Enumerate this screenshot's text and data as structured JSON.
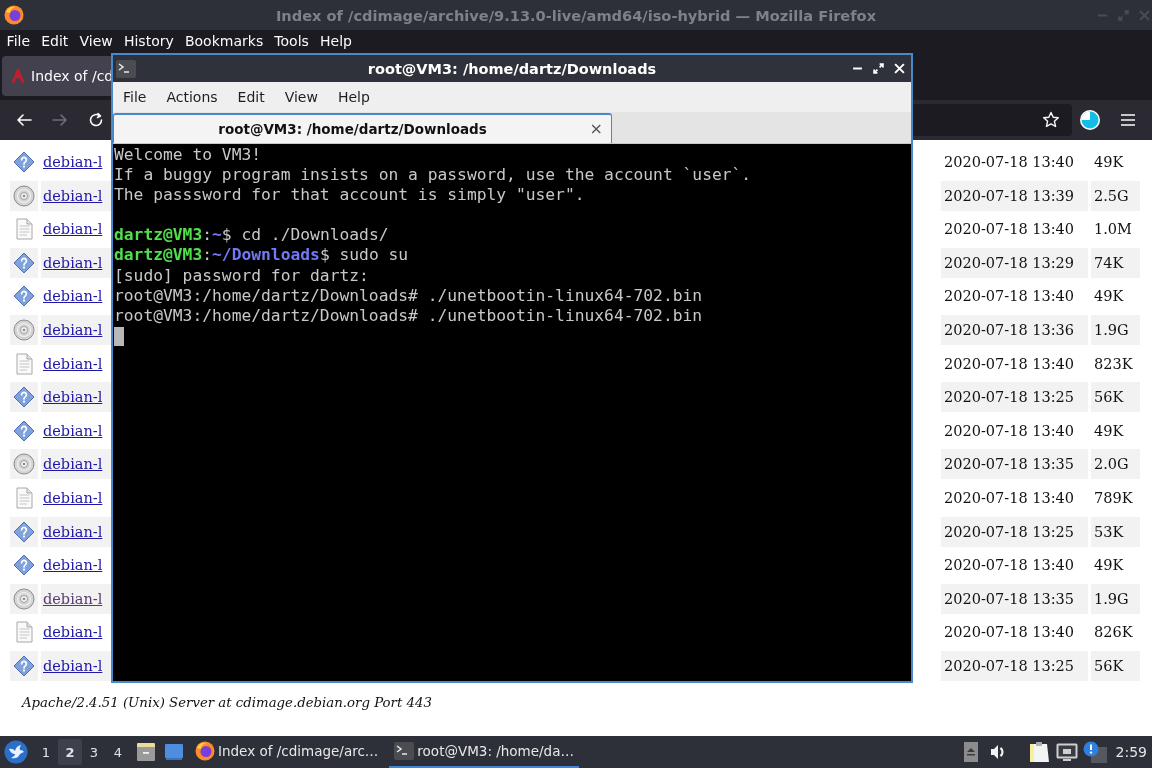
{
  "firefox": {
    "title": "Index of /cdimage/archive/9.13.0-live/amd64/iso-hybrid — Mozilla Firefox",
    "menu": [
      "File",
      "Edit",
      "View",
      "History",
      "Bookmarks",
      "Tools",
      "Help"
    ],
    "tabs": [
      {
        "label": "Index of /cd",
        "selected": true
      }
    ],
    "toolbar": [
      {
        "kind": "back",
        "disabled": false
      },
      {
        "kind": "forward",
        "disabled": true
      },
      {
        "kind": "reload",
        "disabled": false
      }
    ],
    "listing": {
      "rows": [
        {
          "kind": "unknown",
          "name": "debian-l",
          "visited": false,
          "modified": "2020-07-18 13:40",
          "size": "49K"
        },
        {
          "kind": "disc",
          "name": "debian-l",
          "visited": false,
          "modified": "2020-07-18 13:39",
          "size": "2.5G"
        },
        {
          "kind": "text",
          "name": "debian-l",
          "visited": false,
          "modified": "2020-07-18 13:40",
          "size": "1.0M"
        },
        {
          "kind": "unknown",
          "name": "debian-l",
          "visited": false,
          "modified": "2020-07-18 13:29",
          "size": "74K"
        },
        {
          "kind": "unknown",
          "name": "debian-l",
          "visited": false,
          "modified": "2020-07-18 13:40",
          "size": "49K"
        },
        {
          "kind": "disc",
          "name": "debian-l",
          "visited": false,
          "modified": "2020-07-18 13:36",
          "size": "1.9G"
        },
        {
          "kind": "text",
          "name": "debian-l",
          "visited": false,
          "modified": "2020-07-18 13:40",
          "size": "823K"
        },
        {
          "kind": "unknown",
          "name": "debian-l",
          "visited": false,
          "modified": "2020-07-18 13:25",
          "size": "56K"
        },
        {
          "kind": "unknown",
          "name": "debian-l",
          "visited": false,
          "modified": "2020-07-18 13:40",
          "size": "49K"
        },
        {
          "kind": "disc",
          "name": "debian-l",
          "visited": false,
          "modified": "2020-07-18 13:35",
          "size": "2.0G"
        },
        {
          "kind": "text",
          "name": "debian-l",
          "visited": false,
          "modified": "2020-07-18 13:40",
          "size": "789K"
        },
        {
          "kind": "unknown",
          "name": "debian-l",
          "visited": false,
          "modified": "2020-07-18 13:25",
          "size": "53K"
        },
        {
          "kind": "unknown",
          "name": "debian-l",
          "visited": false,
          "modified": "2020-07-18 13:40",
          "size": "49K"
        },
        {
          "kind": "disc",
          "name": "debian-l",
          "visited": true,
          "modified": "2020-07-18 13:35",
          "size": "1.9G"
        },
        {
          "kind": "text",
          "name": "debian-l",
          "visited": false,
          "modified": "2020-07-18 13:40",
          "size": "826K"
        },
        {
          "kind": "unknown",
          "name": "debian-l",
          "visited": false,
          "modified": "2020-07-18 13:25",
          "size": "56K"
        }
      ]
    },
    "footer": "Apache/2.4.51 (Unix) Server at cdimage.debian.org Port 443"
  },
  "terminal": {
    "title": "root@VM3: /home/dartz/Downloads",
    "menu": [
      "File",
      "Actions",
      "Edit",
      "View",
      "Help"
    ],
    "tabs": [
      {
        "label": "root@VM3: /home/dartz/Downloads",
        "selected": true,
        "close": "×"
      }
    ],
    "lines": [
      {
        "kind": "output",
        "segments": [
          {
            "kind": "text",
            "text": "Welcome to VM3!"
          }
        ]
      },
      {
        "kind": "output",
        "segments": [
          {
            "kind": "text",
            "text": "If a buggy program insists on a password, use the account `user`."
          }
        ]
      },
      {
        "kind": "output",
        "segments": [
          {
            "kind": "text",
            "text": "The passsword for that account is simply \"user\"."
          }
        ]
      },
      {
        "kind": "blank"
      },
      {
        "kind": "output",
        "segments": [
          {
            "kind": "user",
            "text": "dartz@VM3"
          },
          {
            "kind": "text",
            "text": ":"
          },
          {
            "kind": "path",
            "text": "~"
          },
          {
            "kind": "text",
            "text": "$ cd ./Downloads/"
          }
        ]
      },
      {
        "kind": "output",
        "segments": [
          {
            "kind": "user",
            "text": "dartz@VM3"
          },
          {
            "kind": "text",
            "text": ":"
          },
          {
            "kind": "path",
            "text": "~/Downloads"
          },
          {
            "kind": "text",
            "text": "$ sudo su"
          }
        ]
      },
      {
        "kind": "output",
        "segments": [
          {
            "kind": "text",
            "text": "[sudo] password for dartz:"
          }
        ]
      },
      {
        "kind": "output",
        "segments": [
          {
            "kind": "text",
            "text": "root@VM3:/home/dartz/Downloads# ./unetbootin-linux64-702.bin"
          }
        ]
      },
      {
        "kind": "output",
        "segments": [
          {
            "kind": "text",
            "text": "root@VM3:/home/dartz/Downloads# ./unetbootin-linux64-702.bin"
          }
        ]
      }
    ]
  },
  "taskbar": {
    "workspaces": [
      {
        "label": "1",
        "selected": false
      },
      {
        "label": "2",
        "selected": true
      },
      {
        "label": "3",
        "selected": false
      },
      {
        "label": "4",
        "selected": false
      }
    ],
    "tasks": [
      {
        "kind": "browser",
        "label": "Index of /cdimage/arc…",
        "selected": false
      },
      {
        "kind": "terminal",
        "label": "root@VM3: /home/da…",
        "selected": true
      }
    ],
    "clock": "2:59"
  }
}
